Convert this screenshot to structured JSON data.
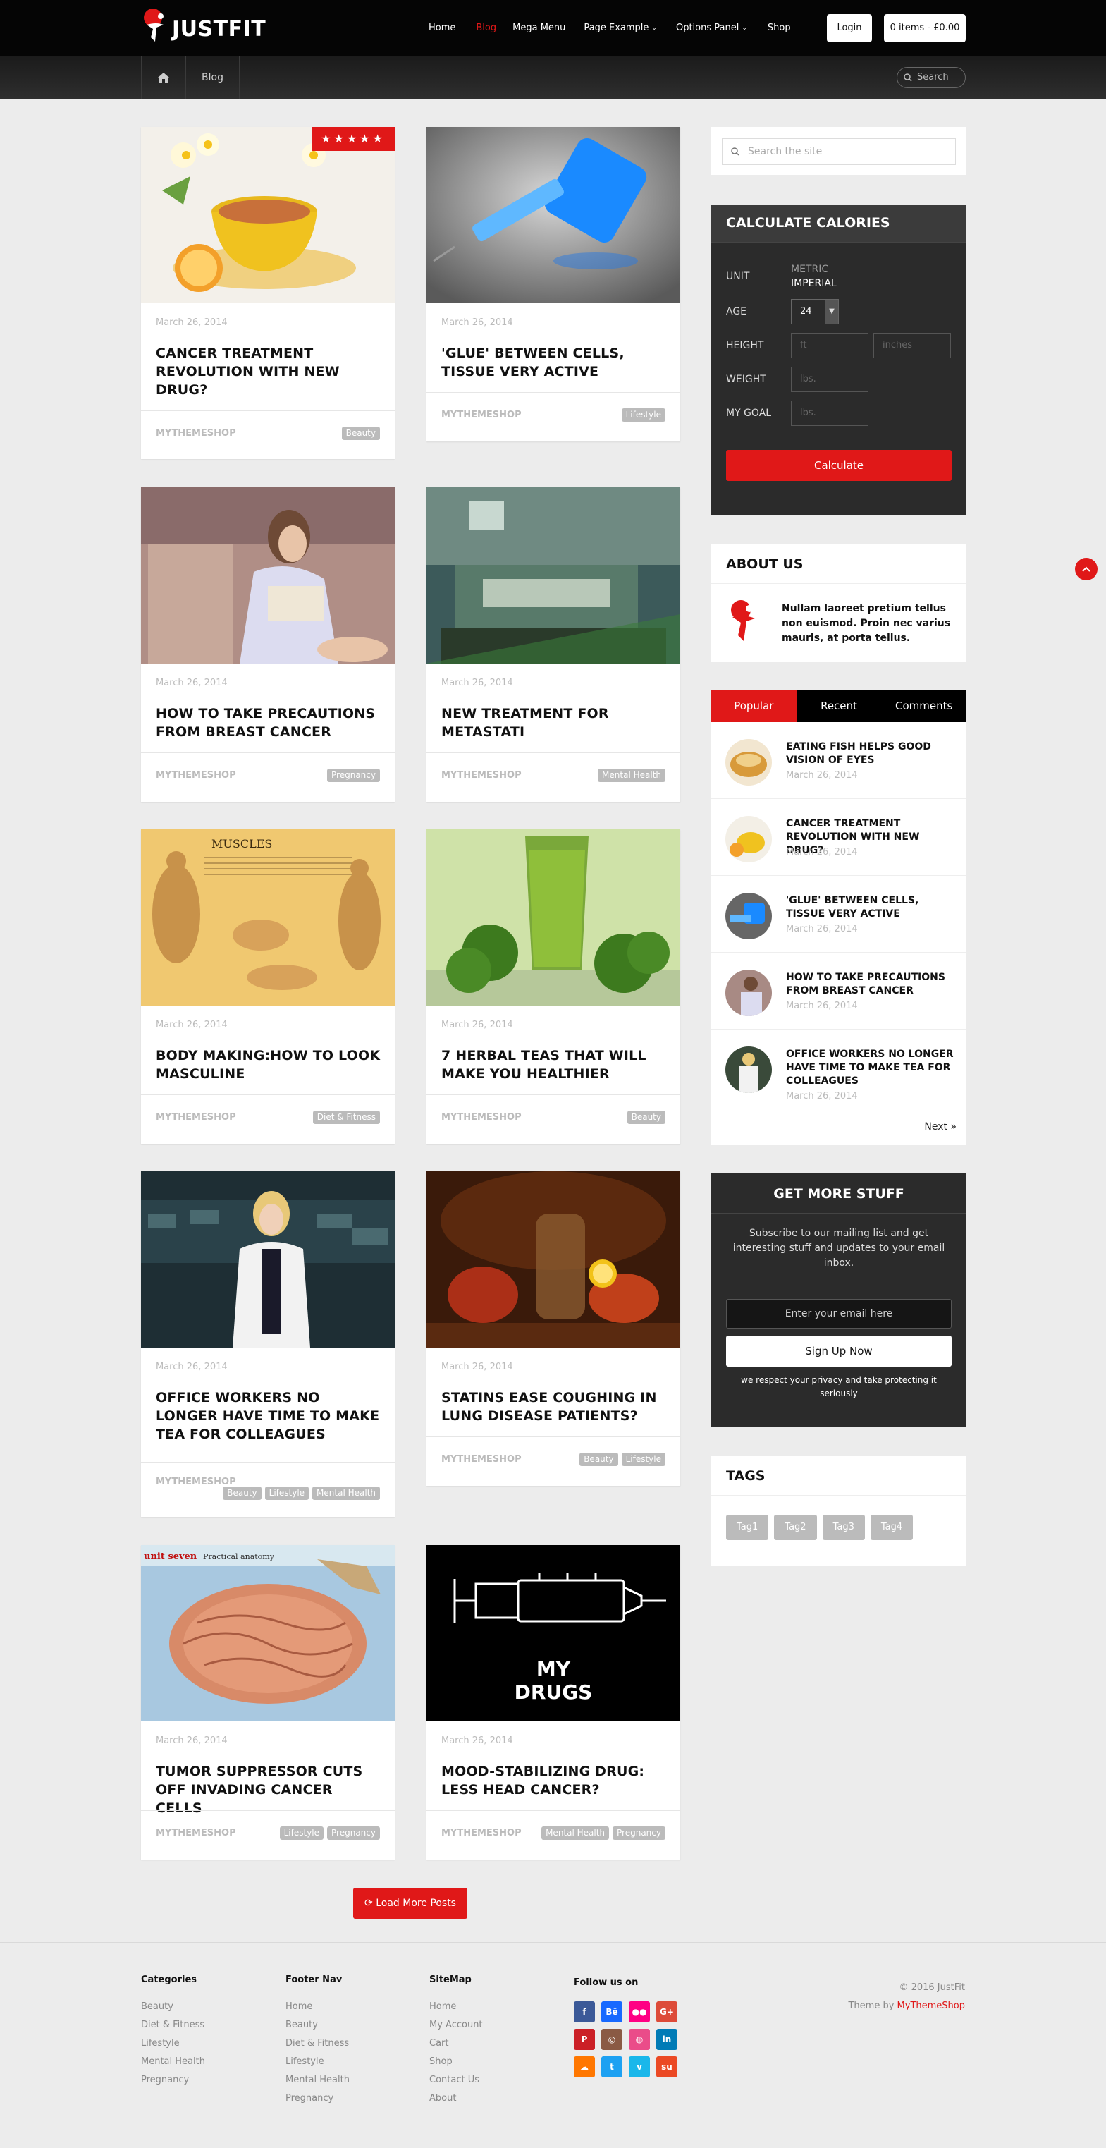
{
  "header": {
    "logo_text": "JUSTFIT",
    "nav": [
      "Home",
      "Blog",
      "Mega Menu",
      "Page Example",
      "Options Panel",
      "Shop"
    ],
    "active_nav": "Blog",
    "login_label": "Login",
    "cart_label": "0 items - £0.00"
  },
  "breadcrumb": {
    "current": "Blog",
    "search_placeholder": "Search"
  },
  "posts": [
    {
      "date": "March 26, 2014",
      "title": "CANCER TREATMENT REVOLUTION WITH NEW DRUG?",
      "author": "MYTHEMESHOP",
      "tags": [
        "Beauty"
      ],
      "rating": "★★★★★"
    },
    {
      "date": "March 26, 2014",
      "title": "'GLUE' BETWEEN CELLS, TISSUE VERY ACTIVE",
      "author": "MYTHEMESHOP",
      "tags": [
        "Lifestyle"
      ]
    },
    {
      "date": "March 26, 2014",
      "title": "HOW TO TAKE PRECAUTIONS FROM BREAST CANCER",
      "author": "MYTHEMESHOP",
      "tags": [
        "Pregnancy"
      ]
    },
    {
      "date": "March 26, 2014",
      "title": "NEW TREATMENT FOR METASTATI",
      "author": "MYTHEMESHOP",
      "tags": [
        "Mental Health"
      ]
    },
    {
      "date": "March 26, 2014",
      "title": "BODY MAKING:HOW TO LOOK MASCULINE",
      "author": "MYTHEMESHOP",
      "tags": [
        "Diet & Fitness"
      ]
    },
    {
      "date": "March 26, 2014",
      "title": "7 HERBAL TEAS THAT WILL MAKE YOU HEALTHIER",
      "author": "MYTHEMESHOP",
      "tags": [
        "Beauty"
      ]
    },
    {
      "date": "March 26, 2014",
      "title": "OFFICE WORKERS NO LONGER HAVE TIME TO MAKE TEA FOR COLLEAGUES",
      "author": "MYTHEMESHOP",
      "tags": [
        "Beauty",
        "Lifestyle",
        "Mental Health"
      ]
    },
    {
      "date": "March 26, 2014",
      "title": "STATINS EASE COUGHING IN LUNG DISEASE PATIENTS?",
      "author": "MYTHEMESHOP",
      "tags": [
        "Beauty",
        "Lifestyle"
      ]
    },
    {
      "date": "March 26, 2014",
      "title": "TUMOR SUPPRESSOR CUTS OFF INVADING CANCER CELLS",
      "author": "MYTHEMESHOP",
      "tags": [
        "Lifestyle",
        "Pregnancy"
      ]
    },
    {
      "date": "March 26, 2014",
      "title": "MOOD-STABILIZING DRUG: LESS HEAD CANCER?",
      "author": "MYTHEMESHOP",
      "tags": [
        "Mental Health",
        "Pregnancy"
      ]
    }
  ],
  "image_text": {
    "muscles": "MUSCLES",
    "brain_label": "unit seven",
    "brain_sub": "Practical anatomy",
    "drugs_line1": "MY",
    "drugs_line2": "DRUGS"
  },
  "load_more": "Load More Posts",
  "sidebar": {
    "search_placeholder": "Search the site",
    "calc": {
      "title": "CALCULATE CALORIES",
      "unit_label": "UNIT",
      "unit_metric": "METRIC",
      "unit_imperial": "IMPERIAL",
      "age_label": "AGE",
      "age_value": "24",
      "height_label": "HEIGHT",
      "height_ft": "ft",
      "height_in": "inches",
      "weight_label": "WEIGHT",
      "weight_ph": "lbs.",
      "goal_label": "MY GOAL",
      "goal_ph": "lbs.",
      "button": "Calculate"
    },
    "about": {
      "title": "ABOUT US",
      "text": "Nullam laoreet pretium tellus non euismod. Proin nec varius mauris, at porta tellus."
    },
    "tabs": [
      "Popular",
      "Recent",
      "Comments"
    ],
    "popular": [
      {
        "title": "EATING FISH HELPS GOOD VISION OF EYES",
        "date": "March 26, 2014"
      },
      {
        "title": "CANCER TREATMENT REVOLUTION WITH NEW DRUG?",
        "date": "March 26, 2014"
      },
      {
        "title": "'GLUE' BETWEEN CELLS, TISSUE VERY ACTIVE",
        "date": "March 26, 2014"
      },
      {
        "title": "HOW TO TAKE PRECAUTIONS FROM BREAST CANCER",
        "date": "March 26, 2014"
      },
      {
        "title": "OFFICE WORKERS NO LONGER HAVE TIME TO MAKE TEA FOR COLLEAGUES",
        "date": "March 26, 2014"
      }
    ],
    "next": "Next »",
    "getmore": {
      "title": "GET MORE STUFF",
      "text": "Subscribe to our mailing list and get interesting stuff and updates to your email inbox.",
      "email_ph": "Enter your email here",
      "button": "Sign Up Now",
      "privacy": "we respect your privacy and take protecting it seriously"
    },
    "tags_title": "TAGS",
    "tags": [
      "Tag1",
      "Tag2",
      "Tag3",
      "Tag4"
    ]
  },
  "footer": {
    "categories": {
      "title": "Categories",
      "items": [
        "Beauty",
        "Diet & Fitness",
        "Lifestyle",
        "Mental Health",
        "Pregnancy"
      ]
    },
    "footer_nav": {
      "title": "Footer Nav",
      "items": [
        "Home",
        "Beauty",
        "Diet & Fitness",
        "Lifestyle",
        "Mental Health",
        "Pregnancy"
      ]
    },
    "sitemap": {
      "title": "SiteMap",
      "items": [
        "Home",
        "My Account",
        "Cart",
        "Shop",
        "Contact Us",
        "About"
      ]
    },
    "follow": "Follow us on",
    "social": [
      {
        "icon": "facebook-icon",
        "glyph": "f",
        "color": "#3b5998"
      },
      {
        "icon": "behance-icon",
        "glyph": "Bē",
        "color": "#1769ff"
      },
      {
        "icon": "flickr-icon",
        "glyph": "●●",
        "color": "#ff0084"
      },
      {
        "icon": "google-plus-icon",
        "glyph": "G+",
        "color": "#dd4b39"
      },
      {
        "icon": "pinterest-icon",
        "glyph": "P",
        "color": "#cb2027"
      },
      {
        "icon": "instagram-icon",
        "glyph": "◎",
        "color": "#8a5a44"
      },
      {
        "icon": "dribbble-icon",
        "glyph": "◍",
        "color": "#ea4c89"
      },
      {
        "icon": "linkedin-icon",
        "glyph": "in",
        "color": "#007bb6"
      },
      {
        "icon": "soundcloud-icon",
        "glyph": "☁",
        "color": "#ff7700"
      },
      {
        "icon": "twitter-icon",
        "glyph": "t",
        "color": "#1da1f2"
      },
      {
        "icon": "vimeo-icon",
        "glyph": "v",
        "color": "#1ab7ea"
      },
      {
        "icon": "stumbleupon-icon",
        "glyph": "su",
        "color": "#eb4924"
      }
    ],
    "copyright": "© 2016 JustFit",
    "theme_by": "Theme by",
    "theme_link": "MyThemeShop"
  }
}
